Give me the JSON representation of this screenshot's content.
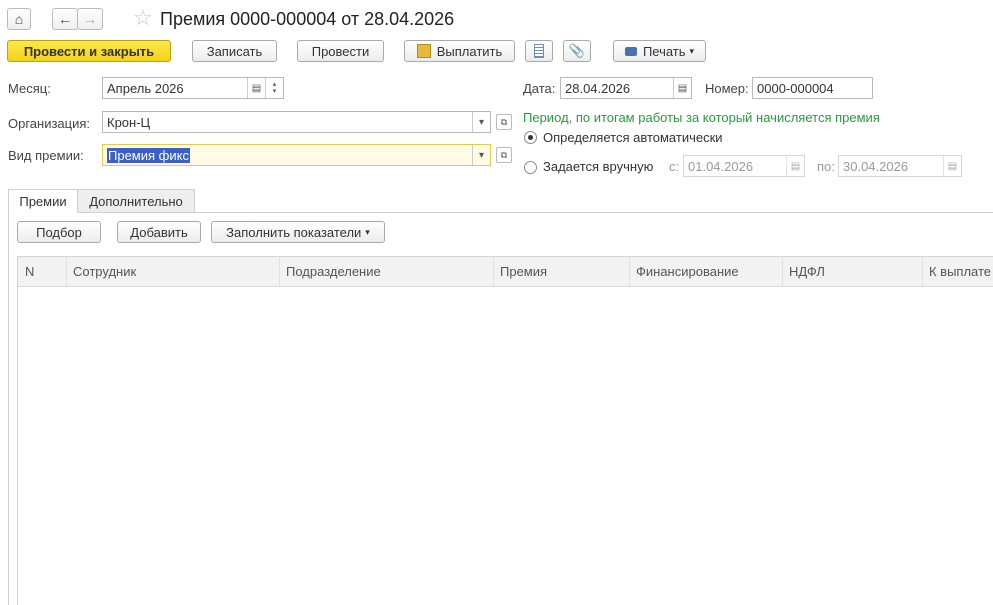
{
  "title": "Премия 0000-000004 от 28.04.2026",
  "toolbar": {
    "post_close": "Провести и закрыть",
    "save": "Записать",
    "post": "Провести",
    "pay": "Выплатить",
    "print": "Печать"
  },
  "form": {
    "month_label": "Месяц:",
    "month_value": "Апрель 2026",
    "org_label": "Организация:",
    "org_value": "Крон-Ц",
    "bonus_type_label": "Вид премии:",
    "bonus_type_value": "Премия фикс",
    "date_label": "Дата:",
    "date_value": "28.04.2026",
    "number_label": "Номер:",
    "number_value": "0000-000004",
    "period_caption": "Период, по итогам работы за который начисляется премия",
    "radio_auto": "Определяется автоматически",
    "radio_manual": "Задается вручную",
    "from_label": "с:",
    "from_value": "01.04.2026",
    "to_label": "по:",
    "to_value": "30.04.2026"
  },
  "tabs": [
    {
      "label": "Премии",
      "active": true
    },
    {
      "label": "Дополнительно",
      "active": false
    }
  ],
  "table_toolbar": {
    "select": "Подбор",
    "add": "Добавить",
    "fill": "Заполнить показатели"
  },
  "columns": [
    "N",
    "Сотрудник",
    "Подразделение",
    "Премия",
    "Финансирование",
    "НДФЛ",
    "К выплате"
  ],
  "colors": {
    "primary_button": "#f4d21b",
    "period_caption": "#2a9a3a",
    "selection": "#3b5fc7"
  }
}
